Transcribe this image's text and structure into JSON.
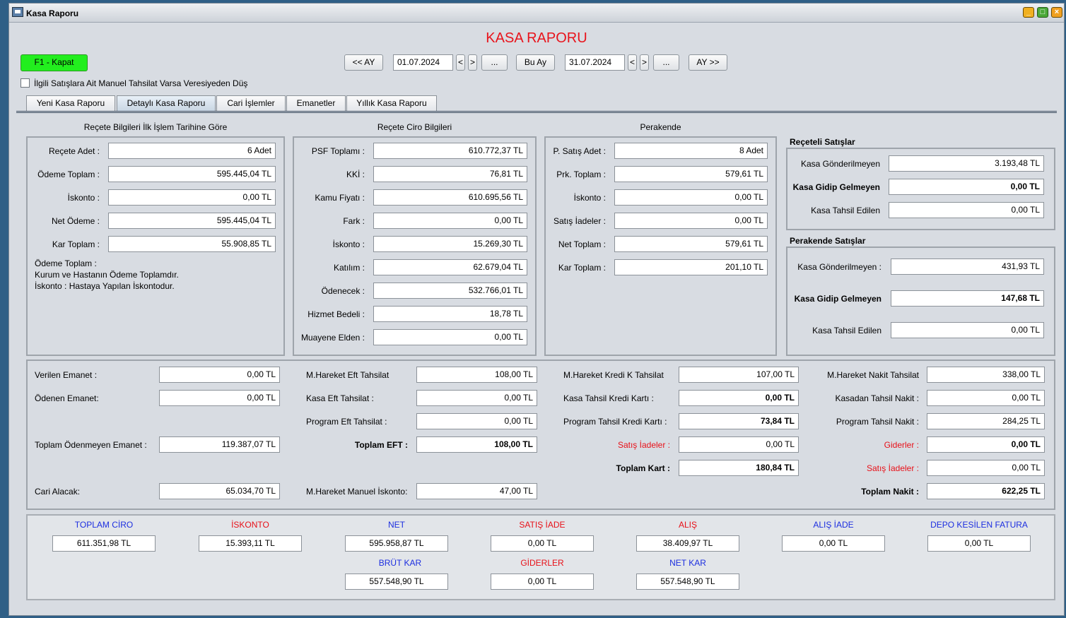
{
  "window": {
    "title": "Kasa Raporu"
  },
  "report_title": "KASA RAPORU",
  "toolbar": {
    "close_label": "F1 - Kapat",
    "prev_month": "<< AY",
    "start_date": "01.07.2024",
    "lt": "<",
    "gt": ">",
    "dots": "...",
    "this_month": "Bu Ay",
    "end_date": "31.07.2024",
    "next_month": "AY >>"
  },
  "checkbox_label": "İlgili Satışlara Ait Manuel Tahsilat Varsa Veresiyeden Düş",
  "tabs": [
    "Yeni Kasa Raporu",
    "Detaylı Kasa Raporu",
    "Cari İşlemler",
    "Emanetler",
    "Yıllık Kasa Raporu"
  ],
  "recete_bilgileri": {
    "title": "Reçete Bilgileri İlk İşlem Tarihine Göre",
    "rows": [
      {
        "label": "Reçete Adet :",
        "value": "6 Adet"
      },
      {
        "label": "Ödeme Toplam :",
        "value": "595.445,04 TL"
      },
      {
        "label": "İskonto :",
        "value": "0,00 TL"
      },
      {
        "label": "Net Ödeme :",
        "value": "595.445,04 TL"
      },
      {
        "label": "Kar Toplam :",
        "value": "55.908,85 TL"
      }
    ],
    "note1": "Ödeme Toplam :",
    "note2": "Kurum ve Hastanın Ödeme Toplamdır.",
    "note3": "İskonto : Hastaya Yapılan İskontodur."
  },
  "recete_ciro": {
    "title": "Reçete Ciro Bilgileri",
    "rows": [
      {
        "label": "PSF Toplamı :",
        "value": "610.772,37 TL"
      },
      {
        "label": "KKİ :",
        "value": "76,81 TL"
      },
      {
        "label": "Kamu Fiyatı :",
        "value": "610.695,56 TL"
      },
      {
        "label": "Fark :",
        "value": "0,00 TL"
      },
      {
        "label": "İskonto :",
        "value": "15.269,30 TL"
      },
      {
        "label": "Katılım :",
        "value": "62.679,04 TL"
      },
      {
        "label": "Ödenecek :",
        "value": "532.766,01 TL"
      },
      {
        "label": "Hizmet Bedeli :",
        "value": "18,78 TL"
      },
      {
        "label": "Muayene Elden :",
        "value": "0,00 TL"
      }
    ]
  },
  "perakende": {
    "title": "Perakende",
    "rows": [
      {
        "label": "P. Satış Adet :",
        "value": "8 Adet"
      },
      {
        "label": "Prk. Toplam :",
        "value": "579,61 TL"
      },
      {
        "label": "İskonto :",
        "value": "0,00 TL"
      },
      {
        "label": "Satış İadeler :",
        "value": "0,00 TL"
      },
      {
        "label": "Net Toplam :",
        "value": "579,61 TL"
      },
      {
        "label": "Kar Toplam :",
        "value": "201,10 TL"
      }
    ]
  },
  "receteli_satislar": {
    "title": "Reçeteli Satışlar",
    "rows": [
      {
        "label": "Kasa Gönderilmeyen",
        "value": "3.193,48 TL"
      },
      {
        "label": "Kasa Gidip Gelmeyen",
        "value": "0,00 TL"
      },
      {
        "label": "Kasa Tahsil Edilen",
        "value": "0,00 TL"
      }
    ]
  },
  "perakende_satislar": {
    "title": "Perakende Satışlar",
    "rows": [
      {
        "label": "Kasa Gönderilmeyen :",
        "value": "431,93 TL"
      },
      {
        "label": "Kasa Gidip Gelmeyen",
        "value": "147,68 TL"
      },
      {
        "label": "Kasa Tahsil Edilen",
        "value": "0,00 TL"
      }
    ]
  },
  "emanet": {
    "verilen": {
      "label": "Verilen Emanet :",
      "value": "0,00 TL"
    },
    "odenen": {
      "label": "Ödenen Emanet:",
      "value": "0,00 TL"
    },
    "toplam_odenmeyen": {
      "label": "Toplam Ödenmeyen Emanet :",
      "value": "119.387,07 TL"
    },
    "cari_alacak": {
      "label": "Cari Alacak:",
      "value": "65.034,70 TL"
    }
  },
  "eft": {
    "mhareket": {
      "label": "M.Hareket Eft Tahsilat",
      "value": "108,00 TL"
    },
    "kasa": {
      "label": "Kasa Eft Tahsilat :",
      "value": "0,00 TL"
    },
    "program": {
      "label": "Program Eft Tahsilat :",
      "value": "0,00 TL"
    },
    "toplam": {
      "label": "Toplam EFT :",
      "value": "108,00 TL"
    },
    "manuel_iskonto": {
      "label": "M.Hareket Manuel İskonto:",
      "value": "47,00 TL"
    }
  },
  "kart": {
    "mhareket": {
      "label": "M.Hareket Kredi K Tahsilat",
      "value": "107,00 TL"
    },
    "kasa": {
      "label": "Kasa Tahsil Kredi Kartı :",
      "value": "0,00 TL"
    },
    "program": {
      "label": "Program Tahsil Kredi Kartı :",
      "value": "73,84 TL"
    },
    "iadeler": {
      "label": "Satış İadeler :",
      "value": "0,00 TL"
    },
    "toplam": {
      "label": "Toplam Kart :",
      "value": "180,84 TL"
    }
  },
  "nakit": {
    "mhareket": {
      "label": "M.Hareket Nakit Tahsilat",
      "value": "338,00 TL"
    },
    "kasadan": {
      "label": "Kasadan Tahsil Nakit :",
      "value": "0,00 TL"
    },
    "program": {
      "label": "Program Tahsil Nakit :",
      "value": "284,25 TL"
    },
    "giderler": {
      "label": "Giderler :",
      "value": "0,00 TL"
    },
    "iadeler": {
      "label": "Satış İadeler :",
      "value": "0,00 TL"
    },
    "toplam": {
      "label": "Toplam Nakit :",
      "value": "622,25 TL"
    }
  },
  "summary": {
    "toplam_ciro": {
      "label": "TOPLAM CİRO",
      "value": "611.351,98 TL"
    },
    "iskonto": {
      "label": "İSKONTO",
      "value": "15.393,11 TL"
    },
    "net": {
      "label": "NET",
      "value": "595.958,87 TL"
    },
    "satis_iade": {
      "label": "SATIŞ İADE",
      "value": "0,00 TL"
    },
    "alis": {
      "label": "ALIŞ",
      "value": "38.409,97 TL"
    },
    "alis_iade": {
      "label": "ALIŞ İADE",
      "value": "0,00 TL"
    },
    "depo_fatura": {
      "label": "DEPO KESİLEN FATURA",
      "value": "0,00 TL"
    },
    "brut_kar": {
      "label": "BRÜT KAR",
      "value": "557.548,90 TL"
    },
    "giderler": {
      "label": "GİDERLER",
      "value": "0,00 TL"
    },
    "net_kar": {
      "label": "NET KAR",
      "value": "557.548,90 TL"
    }
  },
  "colors": {
    "title_red": "#e8141c",
    "label_blue": "#1c2ee0",
    "close_green": "#22ee1e"
  }
}
